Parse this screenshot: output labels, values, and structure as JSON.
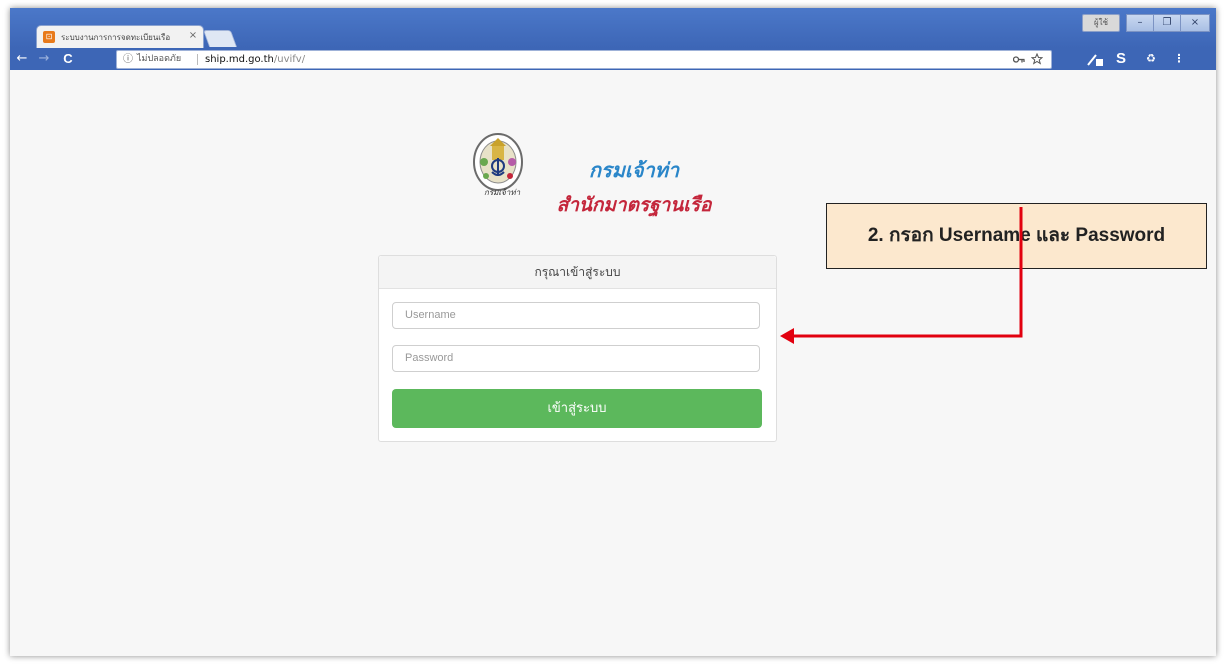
{
  "browser": {
    "tab_title": "ระบบงานการการจดทะเบียนเรือ",
    "tab_close": "×",
    "favicon_glyph": "⊡",
    "profile_label": "ผู้ใช้",
    "window_buttons": [
      "–",
      "❐",
      "×"
    ],
    "nav_icons": {
      "back": "←",
      "forward": "→",
      "reload": "C"
    },
    "omnibox": {
      "info_glyph": "ⓘ",
      "security_label": "ไม่ปลอดภัย",
      "url_host": "ship.md.go.th",
      "url_path": "/uvifv/"
    },
    "toolbar_icons": [
      "key-icon",
      "star-icon",
      "extension-icon",
      "s-extension-icon",
      "recycle-icon",
      "menu-icon"
    ]
  },
  "page": {
    "logo": {
      "line1": "กรมเจ้าท่า",
      "line2": "สำนักมาตรฐานเรือ",
      "seal_caption": "กรมเจ้าท่า"
    },
    "login_panel": {
      "heading": "กรุณาเข้าสู่ระบบ",
      "username_placeholder": "Username",
      "password_placeholder": "Password",
      "submit_label": "เข้าสู่ระบบ"
    },
    "colors": {
      "submit_button": "#5cb85c",
      "browser_chrome": "#3d66b6",
      "callout_bg": "#fce8ce",
      "arrow": "#e2000f"
    }
  },
  "annotation": {
    "callout_text": "2. กรอก Username และ Password"
  }
}
